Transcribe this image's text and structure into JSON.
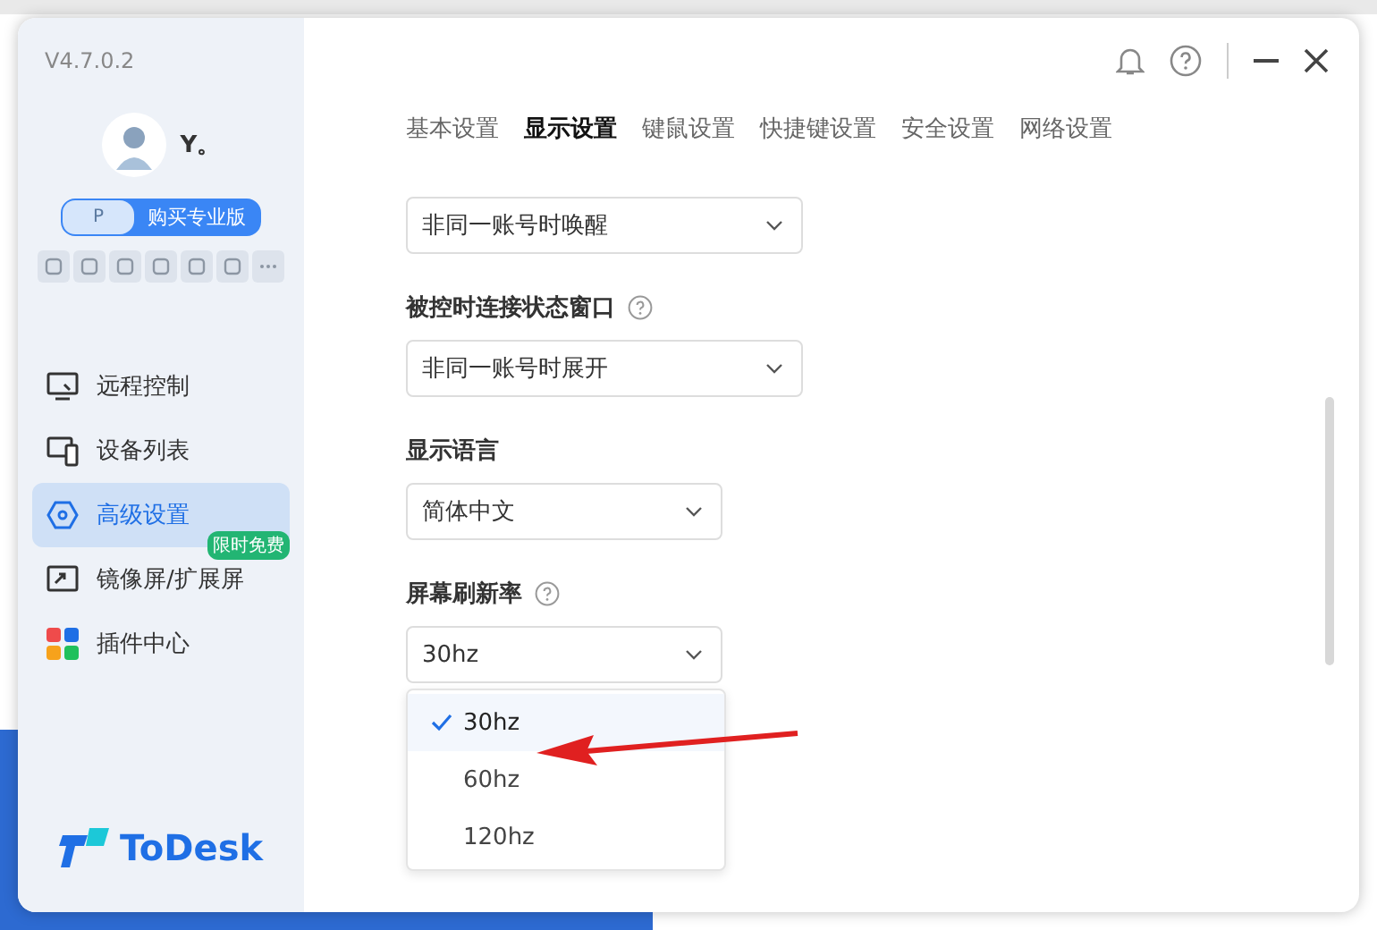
{
  "sidebar": {
    "version": "V4.7.0.2",
    "user": {
      "name": "Y。"
    },
    "pro_button": {
      "icon_label": "P",
      "label": "购买专业版"
    },
    "nav": [
      {
        "label": "远程控制",
        "selected": false
      },
      {
        "label": "设备列表",
        "selected": false
      },
      {
        "label": "高级设置",
        "selected": true
      },
      {
        "label": "镜像屏/扩展屏",
        "selected": false,
        "badge": "限时免费"
      },
      {
        "label": "插件中心",
        "selected": false
      }
    ],
    "logo": "ToDesk"
  },
  "tabs": [
    {
      "label": "基本设置",
      "selected": false
    },
    {
      "label": "显示设置",
      "selected": true
    },
    {
      "label": "键鼠设置",
      "selected": false
    },
    {
      "label": "快捷键设置",
      "selected": false
    },
    {
      "label": "安全设置",
      "selected": false
    },
    {
      "label": "网络设置",
      "selected": false
    }
  ],
  "settings": [
    {
      "kind": "select",
      "value": "非同一账号时唤醒",
      "wide": true
    },
    {
      "kind": "heading",
      "label": "被控时连接状态窗口",
      "help": true
    },
    {
      "kind": "select",
      "value": "非同一账号时展开",
      "wide": true
    },
    {
      "kind": "heading",
      "label": "显示语言",
      "help": false
    },
    {
      "kind": "select",
      "value": "简体中文",
      "wide": false
    },
    {
      "kind": "heading",
      "label": "屏幕刷新率",
      "help": true
    },
    {
      "kind": "select",
      "value": "30hz",
      "wide": false,
      "expanded": true,
      "options": [
        {
          "label": "30hz",
          "selected": true
        },
        {
          "label": "60hz",
          "selected": false
        },
        {
          "label": "120hz",
          "selected": false
        }
      ]
    }
  ]
}
